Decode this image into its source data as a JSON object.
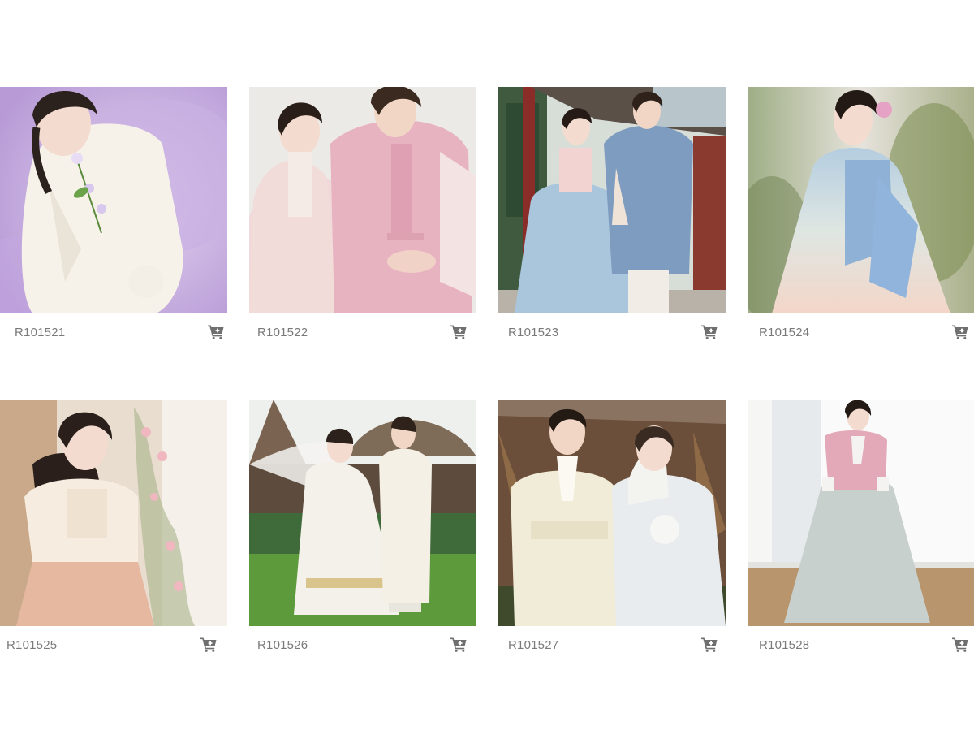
{
  "products": [
    {
      "code": "R101521",
      "image": "hanbok-photo-woman-white-jacket-lavender-skirt-with-flower"
    },
    {
      "code": "R101522",
      "image": "hanbok-photo-couple-pink"
    },
    {
      "code": "R101523",
      "image": "hanbok-photo-couple-palace-blue"
    },
    {
      "code": "R101524",
      "image": "hanbok-photo-woman-blue-jacket-peach-skirt"
    },
    {
      "code": "R101525",
      "image": "hanbok-photo-woman-cream-jacket-peach-skirt-flowers"
    },
    {
      "code": "R101526",
      "image": "hanbok-photo-couple-white-wedding-outdoor"
    },
    {
      "code": "R101527",
      "image": "hanbok-photo-couple-ivory-wedding"
    },
    {
      "code": "R101528",
      "image": "hanbok-photo-woman-pink-jacket-grey-skirt"
    }
  ],
  "icons": {
    "cart": "cart-add-icon"
  },
  "colors": {
    "code_text": "#7a7a7a",
    "icon": "#6f6f6f"
  }
}
